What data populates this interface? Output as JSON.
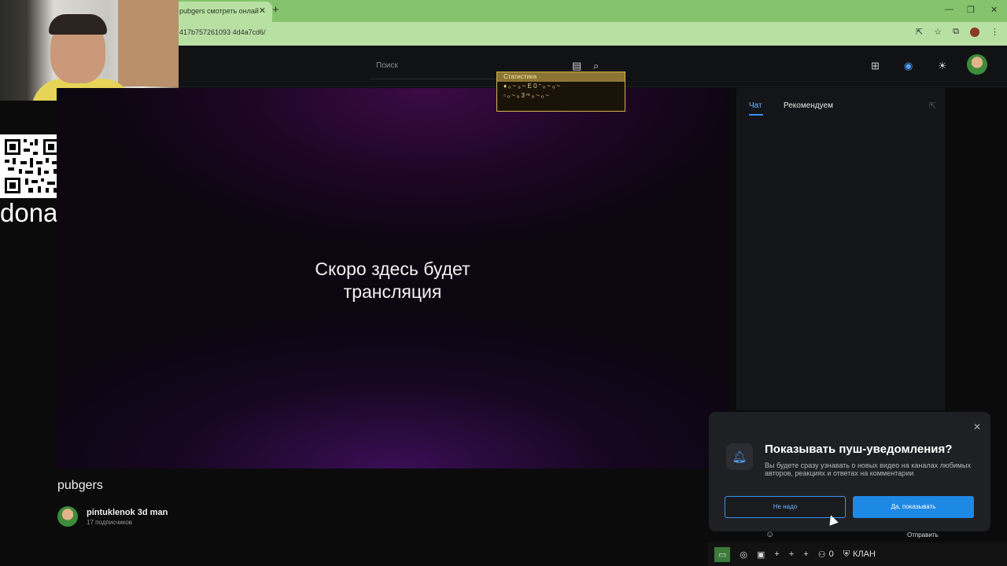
{
  "browser": {
    "tab_title": "pubgers смотреть онлай",
    "tab_close": "✕",
    "new_tab": "+",
    "url": "417b757261093 4d4a7cd6/",
    "window_controls": [
      "—",
      "❐",
      "✕"
    ]
  },
  "header": {
    "search_placeholder": "Поиск"
  },
  "overlay": {
    "donate_text": "donat",
    "stats_title": "Статистика",
    "stats_rows": [
      "♦ ₒ ~ ₒ ~ E 0 ᵔ ₒ ~ ₒ ~",
      "▫ ₒ ~ ₒ 3 ᵐ ₒ ~ ₒ ~"
    ]
  },
  "player": {
    "placeholder_line1": "Скоро здесь будет",
    "placeholder_line2": "трансляция"
  },
  "chat": {
    "tabs": [
      "Чат",
      "Рекомендуем"
    ],
    "send_label": "Отправить"
  },
  "channel": {
    "title": "pubgers",
    "author_name": "pintuklenok 3d man",
    "subscribers": "17 подписчиков"
  },
  "push": {
    "title": "Показывать пуш-уведомления?",
    "text": "Вы будете сразу узнавать о новых видео на каналах любимых авторов, реакциях и ответах на комментарии",
    "decline": "Не надо",
    "accept": "Да, показывать"
  },
  "taskbar": {
    "counter": "0",
    "clan": "КЛАН"
  },
  "colors": {
    "accent": "#1e88e5",
    "browser_green": "#86c36d"
  }
}
